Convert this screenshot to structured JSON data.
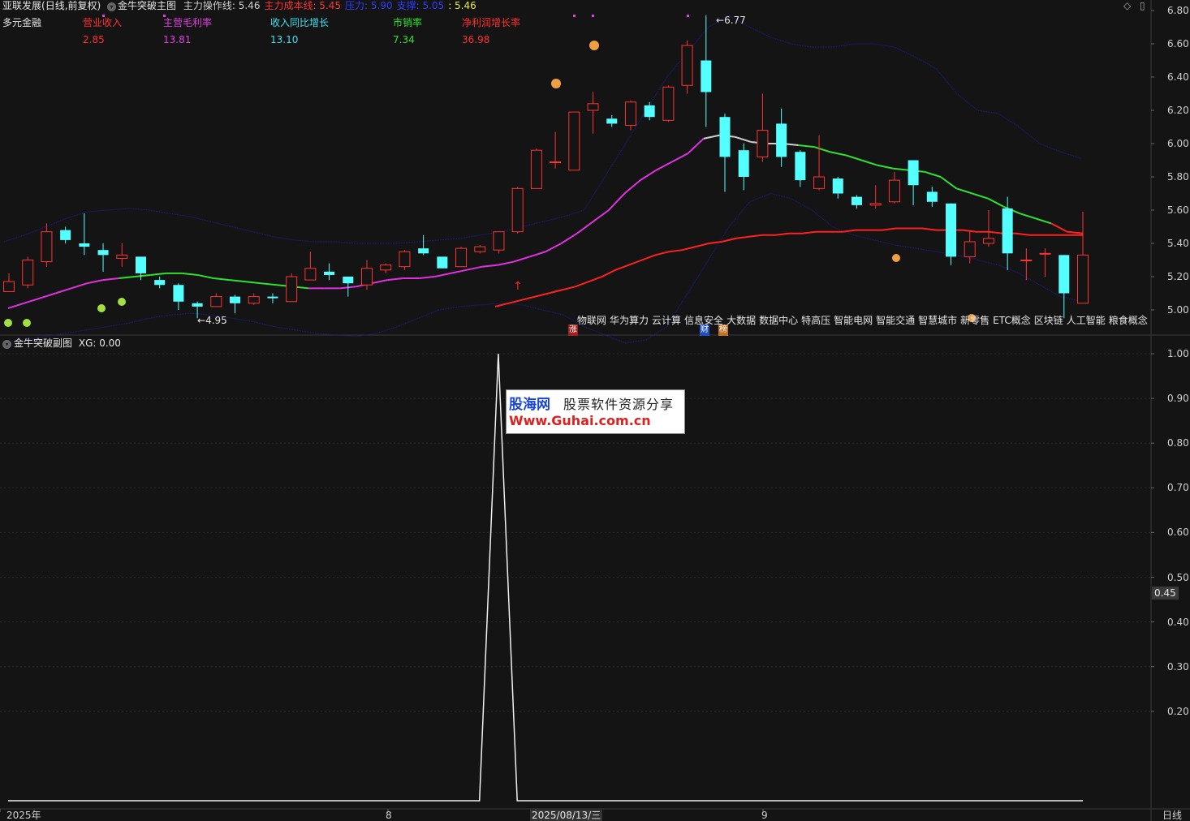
{
  "header": {
    "stock_name": "亚联发展",
    "period_info": "(日线,前复权)",
    "main_indicator": "金牛突破主图",
    "items": [
      {
        "label": "主力操作线: 5.46",
        "color": "#d0d0d0"
      },
      {
        "label": "主力成本线: 5.45",
        "color": "#ff3030"
      },
      {
        "label": "压力: 5.90",
        "color": "#2a3cff"
      },
      {
        "label": "支撑: 5.05",
        "color": "#2a3cff"
      },
      {
        "label": ": 5.46",
        "color": "#e8e840"
      }
    ]
  },
  "fundamentals": {
    "name": "多元金融",
    "columns": [
      {
        "label": "营业收入",
        "value": "2.85",
        "color": "#ff3030"
      },
      {
        "label": "主营毛利率",
        "value": "13.81",
        "color": "#e040e0"
      },
      {
        "label": "收入同比增长",
        "value": "13.10",
        "color": "#40e0f0"
      },
      {
        "label": "市销率",
        "value": "7.34",
        "color": "#30e030"
      },
      {
        "label": "净利润增长率",
        "value": "36.98",
        "color": "#ff3030"
      }
    ]
  },
  "concepts": [
    "物联网",
    "华为算力",
    "云计算",
    "信息安全",
    "大数据",
    "数据中心",
    "特高压",
    "智能电网",
    "智能交通",
    "智慧城市",
    "新零售",
    "ETC概念",
    "区块链",
    "人工智能",
    "粮食概念"
  ],
  "markers": {
    "high_label": "6.77",
    "low_label": "4.95",
    "zhang": "涨",
    "cai": "财",
    "bang": "榜"
  },
  "sub_header": {
    "title": "金牛突破副图",
    "xg": "XG: 0.00"
  },
  "sub_current_value": "0.45",
  "x_axis": {
    "labels": [
      "2025年",
      "8",
      "2025/08/13/三",
      "9"
    ],
    "period": "日线"
  },
  "watermark": {
    "line1": "股海网",
    "line1b": "股票软件资源分享",
    "line2": "Www.Guhai.com.cn"
  },
  "chart_data": [
    {
      "type": "candlestick",
      "ylim": [
        4.9,
        6.85
      ],
      "yticks": [
        5.0,
        5.2,
        5.4,
        5.6,
        5.8,
        6.0,
        6.2,
        6.4,
        6.6,
        6.8
      ],
      "candles": [
        {
          "o": 5.11,
          "h": 5.22,
          "l": 5.11,
          "c": 5.17
        },
        {
          "o": 5.15,
          "h": 5.32,
          "l": 5.13,
          "c": 5.3
        },
        {
          "o": 5.29,
          "h": 5.52,
          "l": 5.26,
          "c": 5.47
        },
        {
          "o": 5.48,
          "h": 5.5,
          "l": 5.4,
          "c": 5.42
        },
        {
          "o": 5.4,
          "h": 5.58,
          "l": 5.33,
          "c": 5.38
        },
        {
          "o": 5.36,
          "h": 5.4,
          "l": 5.23,
          "c": 5.33
        },
        {
          "o": 5.31,
          "h": 5.4,
          "l": 5.26,
          "c": 5.33
        },
        {
          "o": 5.32,
          "h": 5.32,
          "l": 5.18,
          "c": 5.22
        },
        {
          "o": 5.18,
          "h": 5.2,
          "l": 5.13,
          "c": 5.15
        },
        {
          "o": 5.15,
          "h": 5.16,
          "l": 5.0,
          "c": 5.05
        },
        {
          "o": 5.04,
          "h": 5.05,
          "l": 4.95,
          "c": 5.02
        },
        {
          "o": 5.02,
          "h": 5.1,
          "l": 5.02,
          "c": 5.08
        },
        {
          "o": 5.08,
          "h": 5.09,
          "l": 4.98,
          "c": 5.04
        },
        {
          "o": 5.04,
          "h": 5.1,
          "l": 5.03,
          "c": 5.08
        },
        {
          "o": 5.08,
          "h": 5.1,
          "l": 5.04,
          "c": 5.07
        },
        {
          "o": 5.05,
          "h": 5.22,
          "l": 5.05,
          "c": 5.2
        },
        {
          "o": 5.18,
          "h": 5.35,
          "l": 5.18,
          "c": 5.25
        },
        {
          "o": 5.23,
          "h": 5.28,
          "l": 5.18,
          "c": 5.21
        },
        {
          "o": 5.2,
          "h": 5.2,
          "l": 5.08,
          "c": 5.16
        },
        {
          "o": 5.15,
          "h": 5.3,
          "l": 5.12,
          "c": 5.25
        },
        {
          "o": 5.24,
          "h": 5.28,
          "l": 5.22,
          "c": 5.27
        },
        {
          "o": 5.26,
          "h": 5.36,
          "l": 5.24,
          "c": 5.35
        },
        {
          "o": 5.37,
          "h": 5.45,
          "l": 5.33,
          "c": 5.34
        },
        {
          "o": 5.32,
          "h": 5.32,
          "l": 5.25,
          "c": 5.25
        },
        {
          "o": 5.26,
          "h": 5.38,
          "l": 5.26,
          "c": 5.37
        },
        {
          "o": 5.35,
          "h": 5.39,
          "l": 5.34,
          "c": 5.38
        },
        {
          "o": 5.36,
          "h": 5.47,
          "l": 5.34,
          "c": 5.47
        },
        {
          "o": 5.47,
          "h": 5.74,
          "l": 5.46,
          "c": 5.73
        },
        {
          "o": 5.73,
          "h": 5.97,
          "l": 5.73,
          "c": 5.96
        },
        {
          "o": 5.89,
          "h": 6.07,
          "l": 5.85,
          "c": 5.89
        },
        {
          "o": 5.84,
          "h": 6.19,
          "l": 5.84,
          "c": 6.19
        },
        {
          "o": 6.2,
          "h": 6.31,
          "l": 6.06,
          "c": 6.24
        },
        {
          "o": 6.15,
          "h": 6.17,
          "l": 6.1,
          "c": 6.12
        },
        {
          "o": 6.11,
          "h": 6.26,
          "l": 6.08,
          "c": 6.25
        },
        {
          "o": 6.23,
          "h": 6.25,
          "l": 6.14,
          "c": 6.16
        },
        {
          "o": 6.14,
          "h": 6.35,
          "l": 6.13,
          "c": 6.34
        },
        {
          "o": 6.35,
          "h": 6.62,
          "l": 6.3,
          "c": 6.59
        },
        {
          "o": 6.5,
          "h": 6.77,
          "l": 6.1,
          "c": 6.31
        },
        {
          "o": 6.16,
          "h": 6.18,
          "l": 5.71,
          "c": 5.92
        },
        {
          "o": 5.96,
          "h": 6.0,
          "l": 5.72,
          "c": 5.8
        },
        {
          "o": 5.92,
          "h": 6.3,
          "l": 5.89,
          "c": 6.08
        },
        {
          "o": 6.12,
          "h": 6.21,
          "l": 5.86,
          "c": 5.92
        },
        {
          "o": 5.95,
          "h": 5.96,
          "l": 5.74,
          "c": 5.78
        },
        {
          "o": 5.73,
          "h": 6.05,
          "l": 5.72,
          "c": 5.8
        },
        {
          "o": 5.79,
          "h": 5.8,
          "l": 5.67,
          "c": 5.7
        },
        {
          "o": 5.68,
          "h": 5.69,
          "l": 5.61,
          "c": 5.63
        },
        {
          "o": 5.63,
          "h": 5.75,
          "l": 5.61,
          "c": 5.64
        },
        {
          "o": 5.65,
          "h": 5.83,
          "l": 5.64,
          "c": 5.78
        },
        {
          "o": 5.9,
          "h": 5.9,
          "l": 5.63,
          "c": 5.75
        },
        {
          "o": 5.71,
          "h": 5.74,
          "l": 5.62,
          "c": 5.65
        },
        {
          "o": 5.64,
          "h": 5.64,
          "l": 5.27,
          "c": 5.32
        },
        {
          "o": 5.32,
          "h": 5.48,
          "l": 5.28,
          "c": 5.41
        },
        {
          "o": 5.4,
          "h": 5.6,
          "l": 5.38,
          "c": 5.43
        },
        {
          "o": 5.61,
          "h": 5.68,
          "l": 5.24,
          "c": 5.34
        },
        {
          "o": 5.3,
          "h": 5.37,
          "l": 5.18,
          "c": 5.3
        },
        {
          "o": 5.34,
          "h": 5.37,
          "l": 5.2,
          "c": 5.34
        },
        {
          "o": 5.33,
          "h": 5.33,
          "l": 4.95,
          "c": 5.1
        },
        {
          "o": 5.04,
          "h": 5.59,
          "l": 5.04,
          "c": 5.33
        }
      ],
      "series": [
        {
          "name": "主力操作线",
          "values": [
            5.01,
            5.04,
            5.07,
            5.1,
            5.13,
            5.16,
            5.18,
            5.19,
            5.2,
            5.21,
            5.22,
            5.22,
            5.21,
            5.19,
            5.18,
            5.17,
            5.16,
            5.15,
            5.14,
            5.13,
            5.13,
            5.13,
            5.14,
            5.16,
            5.18,
            5.19,
            5.19,
            5.2,
            5.22,
            5.24,
            5.26,
            5.27,
            5.29,
            5.32,
            5.35,
            5.4,
            5.46,
            5.53,
            5.6,
            5.7,
            5.78,
            5.84,
            5.89,
            5.94,
            6.03,
            6.05,
            6.04,
            6.01,
            6.0,
            6.0,
            5.99,
            5.98,
            5.95,
            5.93,
            5.9,
            5.87,
            5.85,
            5.84,
            5.83,
            5.8,
            5.73,
            5.7,
            5.67,
            5.62,
            5.58,
            5.55,
            5.52,
            5.47,
            5.46
          ]
        },
        {
          "name": "主力成本线",
          "values": [
            4.83,
            4.85,
            4.86,
            4.88,
            4.9,
            4.92,
            4.94,
            4.96,
            4.98,
            5.0,
            5.02,
            5.04,
            5.06,
            5.08,
            5.1,
            5.12,
            5.14,
            5.17,
            5.2,
            5.24,
            5.27,
            5.3,
            5.33,
            5.35,
            5.36,
            5.38,
            5.4,
            5.41,
            5.43,
            5.44,
            5.45,
            5.45,
            5.46,
            5.46,
            5.47,
            5.47,
            5.47,
            5.48,
            5.48,
            5.48,
            5.49,
            5.49,
            5.49,
            5.48,
            5.48,
            5.48,
            5.47,
            5.47,
            5.46,
            5.46,
            5.45,
            5.45,
            5.45,
            5.45,
            5.45
          ]
        },
        {
          "name": "压力",
          "values": [
            5.41,
            5.45,
            5.5,
            5.55,
            5.59,
            5.6,
            5.61,
            5.6,
            5.58,
            5.56,
            5.53,
            5.5,
            5.47,
            5.44,
            5.42,
            5.41,
            5.41,
            5.4,
            5.4,
            5.4,
            5.41,
            5.42,
            5.43,
            5.45,
            5.47,
            5.5,
            5.53,
            5.56,
            5.6,
            5.8,
            6.0,
            6.2,
            6.4,
            6.55,
            6.7,
            6.77,
            6.7,
            6.64,
            6.6,
            6.58,
            6.58,
            6.6,
            6.6,
            6.58,
            6.52,
            6.45,
            6.3,
            6.2,
            6.18,
            6.1,
            6.0,
            5.95,
            5.91
          ]
        },
        {
          "name": "支撑",
          "values": [
            4.8,
            4.82,
            4.84,
            4.86,
            4.88,
            4.9,
            4.92,
            4.95,
            4.97,
            4.98,
            4.97,
            4.95,
            4.93,
            4.9,
            4.88,
            4.86,
            4.85,
            4.84,
            4.86,
            4.9,
            4.95,
            5.0,
            5.02,
            5.03,
            5.04,
            5.03,
            5.0,
            4.97,
            4.9,
            4.85,
            4.8,
            4.82,
            4.9,
            5.1,
            5.3,
            5.5,
            5.65,
            5.7,
            5.67,
            5.6,
            5.5,
            5.45,
            5.42,
            5.39,
            5.37,
            5.35,
            5.33,
            5.3,
            5.27,
            5.22,
            5.15,
            5.08,
            5.05
          ]
        }
      ]
    },
    {
      "type": "line",
      "title": "金牛突破副图",
      "ylim": [
        0,
        1.0
      ],
      "yticks": [
        0.2,
        0.3,
        0.4,
        0.5,
        0.6,
        0.7,
        0.8,
        0.9,
        1.0
      ],
      "series": [
        {
          "name": "XG",
          "values": [
            0,
            0,
            0,
            0,
            0,
            0,
            0,
            0,
            0,
            0,
            0,
            0,
            0,
            0,
            0,
            0,
            0,
            0,
            0,
            0,
            0,
            0,
            0,
            0,
            0,
            0,
            1,
            0,
            0,
            0,
            0,
            0,
            0,
            0,
            0,
            0,
            0,
            0,
            0,
            0,
            0,
            0,
            0,
            0,
            0,
            0,
            0,
            0,
            0,
            0,
            0,
            0,
            0,
            0,
            0,
            0,
            0,
            0
          ]
        }
      ]
    }
  ]
}
